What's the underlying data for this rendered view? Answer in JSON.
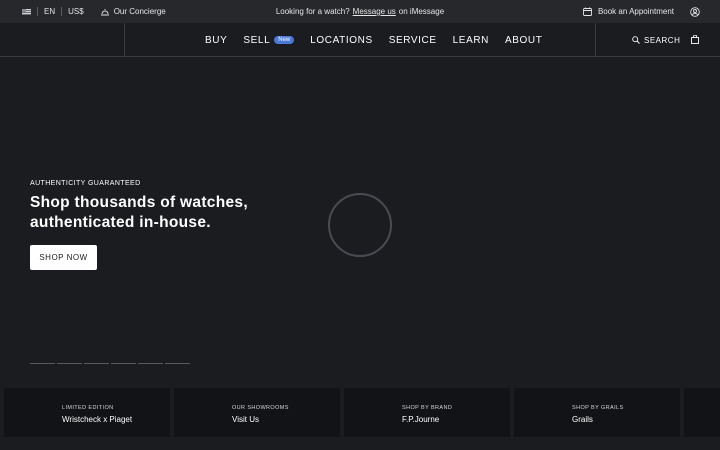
{
  "topbar": {
    "language": "EN",
    "currency": "US$",
    "concierge": "Our Concierge",
    "message_prefix": "Looking for a watch?",
    "message_link": "Message us",
    "message_suffix": "on iMessage",
    "appointment": "Book an Appointment"
  },
  "nav": {
    "items": [
      {
        "label": "BUY"
      },
      {
        "label": "SELL",
        "badge": "New"
      },
      {
        "label": "LOCATIONS"
      },
      {
        "label": "SERVICE"
      },
      {
        "label": "LEARN"
      },
      {
        "label": "ABOUT"
      }
    ],
    "search_label": "SEARCH"
  },
  "hero": {
    "eyebrow": "AUTHENTICITY GUARANTEED",
    "title_line1": "Shop thousands of watches,",
    "title_line2": "authenticated in-house.",
    "cta": "SHOP NOW",
    "slides": 6
  },
  "cards": [
    {
      "eyebrow": "LIMITED EDITION",
      "title": "Wristcheck x Piaget"
    },
    {
      "eyebrow": "OUR SHOWROOMS",
      "title": "Visit Us"
    },
    {
      "eyebrow": "SHOP BY BRAND",
      "title": "F.P.Journe"
    },
    {
      "eyebrow": "SHOP BY GRAILS",
      "title": "Grails"
    }
  ],
  "colors": {
    "background": "#1b1c20",
    "topbar": "#26282c",
    "badge": "#4a78d6",
    "card": "#121316"
  }
}
